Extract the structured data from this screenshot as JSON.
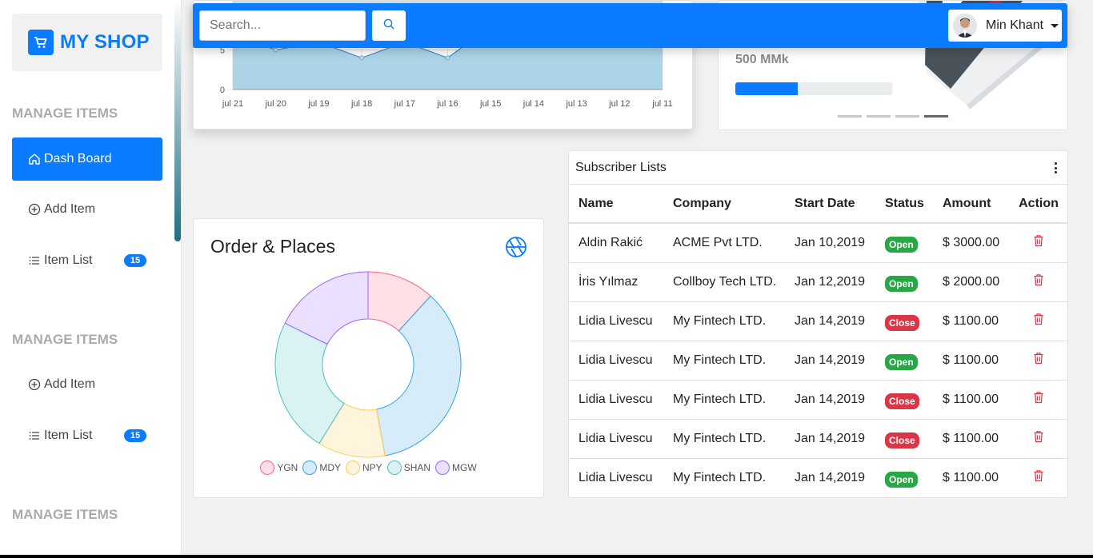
{
  "brand": {
    "name": "MY SHOP",
    "color": "#0b7bff"
  },
  "sidebar": {
    "headings": [
      "MANAGE ITEMS",
      "MANAGE ITEMS",
      "MANAGE ITEMS"
    ],
    "items": [
      {
        "label": "Dash Board",
        "icon": "home-icon",
        "active": true
      },
      {
        "label": "Add Item",
        "icon": "plus-circle-icon"
      },
      {
        "label": "Item List",
        "icon": "list-icon",
        "badge": "15"
      },
      {
        "label": "Add Item",
        "icon": "plus-circle-icon"
      },
      {
        "label": "Item List",
        "icon": "list-icon",
        "badge": "15"
      }
    ]
  },
  "navbar": {
    "search_placeholder": "Search...",
    "search_icon": "search-icon",
    "user_name": "Min Khant"
  },
  "promo": {
    "amount": "500 MMk",
    "progress_percent": 40,
    "carousel_slides": 4,
    "active_slide": 4
  },
  "chart_data": [
    {
      "type": "area",
      "categories": [
        "jul 21",
        "jul 20",
        "jul 19",
        "jul 18",
        "jul 17",
        "jul 16",
        "jul 15",
        "jul 14",
        "jul 13",
        "jul 12",
        "jul 11"
      ],
      "series": [
        {
          "values": [
            7,
            5,
            6,
            4,
            6,
            4,
            8,
            6,
            8,
            8,
            6
          ],
          "color": "#2f8fd8"
        }
      ],
      "y_ticks": [
        "5",
        "0"
      ],
      "ylim": [
        0,
        10
      ]
    },
    {
      "type": "pie",
      "style": "doughnut",
      "title": "Order & Places",
      "categories": [
        "YGN",
        "MDY",
        "NPY",
        "SHAN",
        "MGW"
      ],
      "values": [
        10,
        30,
        10,
        20,
        15
      ],
      "colors": [
        "#ff6384",
        "#36a2eb",
        "#ffcd56",
        "#4bc0c0",
        "#9966ff"
      ]
    }
  ],
  "table": {
    "title": "Subscriber Lists",
    "columns": [
      "Name",
      "Company",
      "Start Date",
      "Status",
      "Amount",
      "Action"
    ],
    "rows": [
      {
        "name": "Aldin Rakić",
        "company": "ACME Pvt LTD.",
        "start_date": "Jan 10,2019",
        "status": "Open",
        "amount": "$ 3000.00"
      },
      {
        "name": "İris Yılmaz",
        "company": "Collboy Tech LTD.",
        "start_date": "Jan 12,2019",
        "status": "Open",
        "amount": "$ 2000.00"
      },
      {
        "name": "Lidia Livescu",
        "company": "My Fintech LTD.",
        "start_date": "Jan 14,2019",
        "status": "Close",
        "amount": "$ 1100.00"
      },
      {
        "name": "Lidia Livescu",
        "company": "My Fintech LTD.",
        "start_date": "Jan 14,2019",
        "status": "Open",
        "amount": "$ 1100.00"
      },
      {
        "name": "Lidia Livescu",
        "company": "My Fintech LTD.",
        "start_date": "Jan 14,2019",
        "status": "Close",
        "amount": "$ 1100.00"
      },
      {
        "name": "Lidia Livescu",
        "company": "My Fintech LTD.",
        "start_date": "Jan 14,2019",
        "status": "Close",
        "amount": "$ 1100.00"
      },
      {
        "name": "Lidia Livescu",
        "company": "My Fintech LTD.",
        "start_date": "Jan 14,2019",
        "status": "Open",
        "amount": "$ 1100.00"
      }
    ],
    "action_icon": "trash-icon",
    "status_colors": {
      "Open": "#28a745",
      "Close": "#dc3545"
    }
  }
}
